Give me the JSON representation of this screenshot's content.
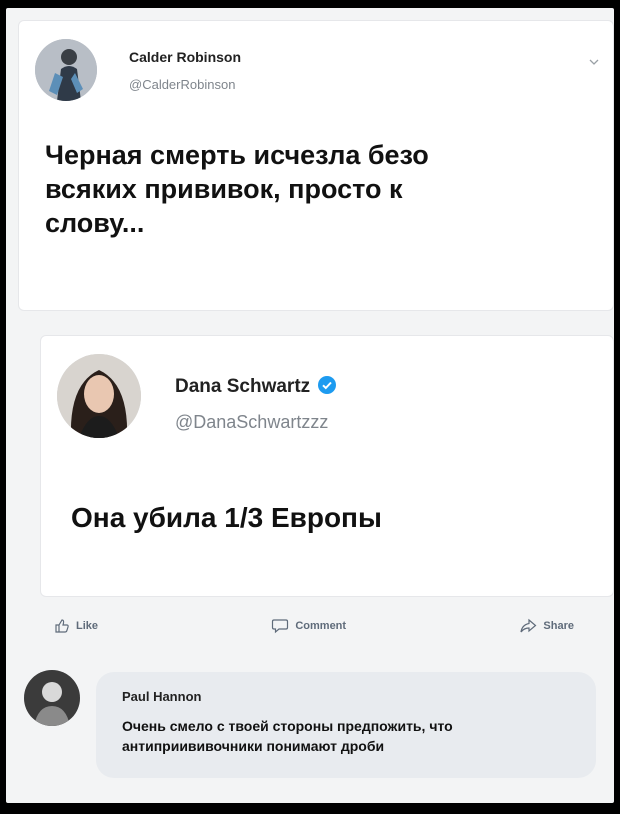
{
  "tweet1": {
    "author_name": "Calder Robinson",
    "author_handle": "@CalderRobinson",
    "text_lines": [
      "Черная смерть исчезла безо",
      "всяких прививок, просто к",
      "слову..."
    ]
  },
  "tweet2": {
    "author_name": "Dana Schwartz",
    "author_handle": "@DanaSchwartzzz",
    "text": "Она убила 1/3 Европы",
    "verified_color": "#1d9bf0"
  },
  "actions": {
    "like_label": "Like",
    "comment_label": "Comment",
    "share_label": "Share"
  },
  "comment": {
    "author_name": "Paul Hannon",
    "text": "Очень смело с твоей стороны предпожить, что антиприививочники понимают дроби"
  }
}
